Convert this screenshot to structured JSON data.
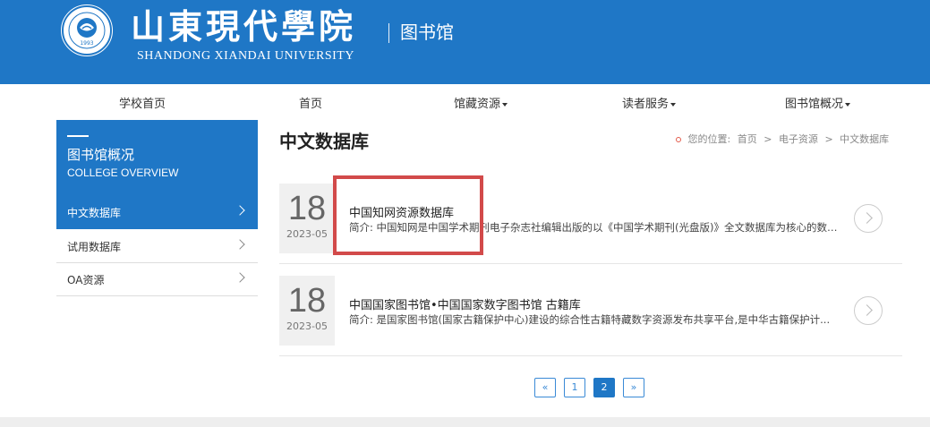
{
  "header": {
    "logo_cn": "山東現代學院",
    "logo_en": "SHANDONG XIANDAI UNIVERSITY",
    "seal_year": "1993",
    "subtitle": "图书馆"
  },
  "nav": [
    {
      "label": "学校首页",
      "dropdown": false
    },
    {
      "label": "首页",
      "dropdown": false
    },
    {
      "label": "馆藏资源",
      "dropdown": true
    },
    {
      "label": "读者服务",
      "dropdown": true
    },
    {
      "label": "图书馆概况",
      "dropdown": true
    }
  ],
  "sidebar": {
    "title": "图书馆概况",
    "subtitle": "COLLEGE OVERVIEW",
    "items": [
      {
        "label": "中文数据库",
        "active": true
      },
      {
        "label": "试用数据库",
        "active": false
      },
      {
        "label": "OA资源",
        "active": false
      }
    ]
  },
  "main": {
    "title": "中文数据库",
    "breadcrumb": {
      "prefix": "您的位置:",
      "items": [
        "首页",
        "电子资源",
        "中文数据库"
      ],
      "separator": ">"
    },
    "entries": [
      {
        "day": "18",
        "year_month": "2023-05",
        "title": "中国知网资源数据库",
        "desc": "简介:  中国知网是中国学术期刊电子杂志社编辑出版的以《中国学术期刊(光盘版)》全文数据库为核心的数据..."
      },
      {
        "day": "18",
        "year_month": "2023-05",
        "title": "中国国家图书馆•中国国家数字图书馆 古籍库",
        "desc": "简介: 是国家图书馆(国家古籍保护中心)建设的综合性古籍特藏数字资源发布共享平台,是中华古籍保护计..."
      }
    ]
  },
  "pager": {
    "prev": "«",
    "pages": [
      "1",
      "2"
    ],
    "current": "2",
    "next": "»"
  },
  "colors": {
    "brand_blue": "#1f77c6",
    "highlight_red": "#d24a4a"
  }
}
